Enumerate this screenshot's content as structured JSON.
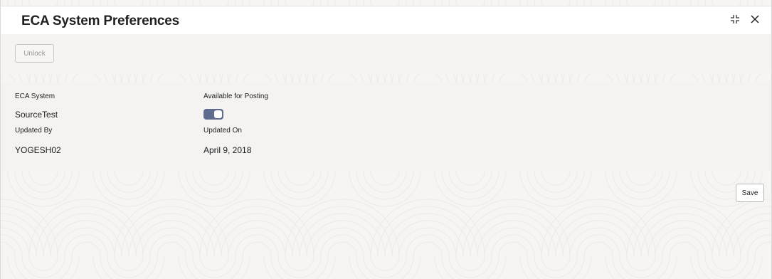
{
  "window": {
    "title": "ECA System Preferences",
    "icons": [
      "collapse-icon",
      "close-icon"
    ]
  },
  "toolbar": {
    "unlock_label": "Unlock"
  },
  "form": {
    "eca_system_label": "ECA System",
    "eca_system_value": "SourceTest",
    "available_for_posting_label": "Available for Posting",
    "available_for_posting_value": true,
    "updated_by_label": "Updated By",
    "updated_by_value": "YOGESH02",
    "updated_on_label": "Updated On",
    "updated_on_value": "April 9, 2018"
  },
  "footer": {
    "save_label": "Save"
  },
  "colors": {
    "toggle_on": "#5e6a8e",
    "background": "#f4f3f2",
    "header": "#ffffff"
  }
}
